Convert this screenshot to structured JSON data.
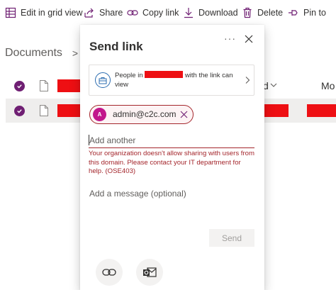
{
  "toolbar": {
    "edit_grid": "Edit in grid view",
    "share": "Share",
    "copy_link": "Copy link",
    "download": "Download",
    "delete": "Delete",
    "pin": "Pin to"
  },
  "breadcrumb": {
    "root": "Documents",
    "separator": ">"
  },
  "list": {
    "col_partial_1": "d",
    "col_partial_2": "Mo"
  },
  "dialog": {
    "title": "Send link",
    "more": "···",
    "permission_prefix": "People in",
    "permission_suffix": "with the link can view",
    "recipient_initial": "A",
    "recipient_email": "admin@c2c.com",
    "add_placeholder": "Add another",
    "error_text": "Your organization doesn't allow sharing with users from this domain. Please contact your IT department for help. (OSE403)",
    "message_placeholder": "Add a message (optional)",
    "send_label": "Send"
  },
  "colors": {
    "accent_purple": "#6f1f73",
    "error_red": "#a4262c",
    "redaction": "#ee0f13",
    "avatar_pink": "#c2168b"
  },
  "icons": [
    "grid-icon",
    "share-icon",
    "link-icon",
    "download-icon",
    "delete-icon",
    "pin-icon",
    "close-icon",
    "briefcase-icon",
    "chevron-right-icon",
    "outlook-icon"
  ]
}
